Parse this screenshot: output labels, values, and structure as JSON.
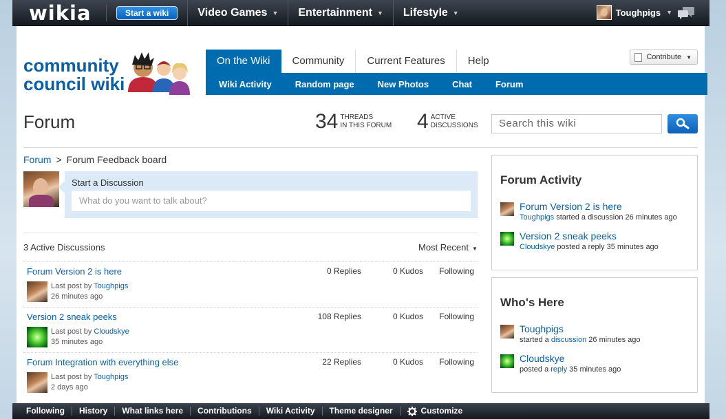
{
  "globalnav": {
    "logo": "wikia",
    "start_wiki": "Start a wiki",
    "hubs": [
      "Video Games",
      "Entertainment",
      "Lifestyle"
    ],
    "username": "Toughpigs"
  },
  "wiki": {
    "wordmark_line1": "community",
    "wordmark_line2": "council wiki"
  },
  "tabs": [
    "On the Wiki",
    "Community",
    "Current Features",
    "Help"
  ],
  "subnav": [
    "Wiki Activity",
    "Random page",
    "New Photos",
    "Chat",
    "Forum"
  ],
  "contribute": "Contribute",
  "header": {
    "title": "Forum",
    "threads_count": "34",
    "threads_label_1": "THREADS",
    "threads_label_2": "IN THIS FORUM",
    "active_count": "4",
    "active_label_1": "ACTIVE",
    "active_label_2": "DISCUSSIONS",
    "search_placeholder": "Search this wiki"
  },
  "breadcrumb": {
    "root": "Forum",
    "separator": ">",
    "current": "Forum Feedback board"
  },
  "new_discussion": {
    "title": "Start a Discussion",
    "placeholder": "What do you want to talk about?"
  },
  "list_header": {
    "count": "3 Active Discussions",
    "sort": "Most Recent"
  },
  "threads": [
    {
      "title": "Forum Version 2 is here",
      "prefix": "Last post by",
      "author": "Toughpigs",
      "time": "26 minutes ago",
      "replies": "0 Replies",
      "kudos": "0 Kudos",
      "follow": "Following"
    },
    {
      "title": "Version 2 sneak peeks",
      "prefix": "Last post by",
      "author": "Cloudskye",
      "time": "35 minutes ago",
      "replies": "108 Replies",
      "kudos": "0 Kudos",
      "follow": "Following"
    },
    {
      "title": "Forum Integration with everything else",
      "prefix": "Last post by",
      "author": "Toughpigs",
      "time": "2 days ago",
      "replies": "22 Replies",
      "kudos": "0 Kudos",
      "follow": "Following"
    }
  ],
  "forum_activity": {
    "title": "Forum Activity",
    "items": [
      {
        "title": "Forum Version 2 is here",
        "user": "Toughpigs",
        "action": "started a discussion 26 minutes ago"
      },
      {
        "title": "Version 2 sneak peeks",
        "user": "Cloudskye",
        "action": "posted a reply 35 minutes ago"
      }
    ]
  },
  "whos_here": {
    "title": "Who's Here",
    "items": [
      {
        "user": "Toughpigs",
        "pre": "started a",
        "link": "discussion",
        "post": "26 minutes ago"
      },
      {
        "user": "Cloudskye",
        "pre": "posted a",
        "link": "reply",
        "post": "35 minutes ago"
      }
    ]
  },
  "toolbar": [
    "Following",
    "History",
    "What links here",
    "Contributions",
    "Wiki Activity",
    "Theme designer",
    "Customize"
  ],
  "colors": {
    "accent": "#006cb0",
    "link": "#0b5fa5",
    "globalbar": "#1d232a"
  }
}
